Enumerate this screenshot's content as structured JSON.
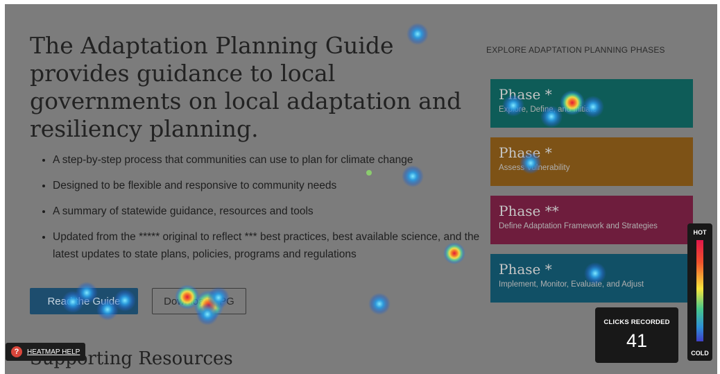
{
  "hero": {
    "title": "The Adaptation Planning Guide provides guidance to local governments on local adaptation and resiliency planning.",
    "bullets": [
      "A step-by-step process that communities can use to plan for climate change",
      "Designed to be flexible and responsive to community needs",
      "A summary of statewide guidance, resources and tools",
      "Updated from the ***** original to reflect *** best practices, best available science, and the latest updates to state plans, policies, programs and regulations"
    ],
    "read_button": "Read the Guide",
    "download_button": "Download APG"
  },
  "supporting": {
    "title": "Supporting Resources"
  },
  "phases": {
    "heading": "EXPLORE ADAPTATION PLANNING PHASES",
    "items": [
      {
        "title": "Phase *",
        "subtitle": "Explore, Define, and Initiate",
        "color": "#0e5c58"
      },
      {
        "title": "Phase *",
        "subtitle": "Assess Vulnerability",
        "color": "#7d5216"
      },
      {
        "title": "Phase **",
        "subtitle": "Define Adaptation Framework and Strategies",
        "color": "#6e1d3d"
      },
      {
        "title": "Phase *",
        "subtitle": "Implement, Monitor, Evaluate, and Adjust",
        "color": "#115066"
      }
    ]
  },
  "heatmap": {
    "help_label": "HEATMAP HELP",
    "help_icon": "question-icon",
    "clicks_label": "CLICKS RECORDED",
    "clicks_count": "41",
    "legend_hot": "HOT",
    "legend_cold": "COLD"
  }
}
